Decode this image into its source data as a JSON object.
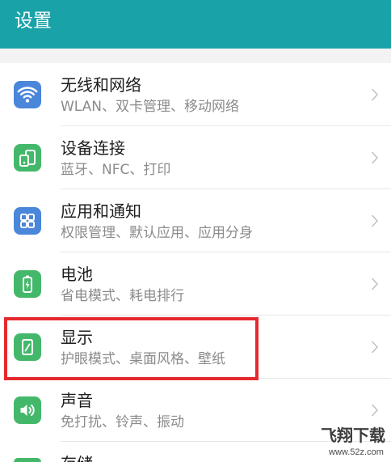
{
  "header": {
    "title": "设置"
  },
  "colors": {
    "header": "#19a2a8",
    "highlight": "#e42a2f"
  },
  "settings": {
    "items": [
      {
        "icon": "wifi-icon",
        "icon_color": "#4a86da",
        "title": "无线和网络",
        "subtitle": "WLAN、双卡管理、移动网络"
      },
      {
        "icon": "device-connection-icon",
        "icon_color": "#44b86a",
        "title": "设备连接",
        "subtitle": "蓝牙、NFC、打印"
      },
      {
        "icon": "apps-icon",
        "icon_color": "#4a86da",
        "title": "应用和通知",
        "subtitle": "权限管理、默认应用、应用分身"
      },
      {
        "icon": "battery-icon",
        "icon_color": "#44b86a",
        "title": "电池",
        "subtitle": "省电模式、耗电排行"
      },
      {
        "icon": "display-icon",
        "icon_color": "#44b86a",
        "title": "显示",
        "subtitle": "护眼模式、桌面风格、壁纸"
      },
      {
        "icon": "sound-icon",
        "icon_color": "#44b86a",
        "title": "声音",
        "subtitle": "免打扰、铃声、振动"
      },
      {
        "icon": "storage-icon",
        "icon_color": "#44b86a",
        "title": "存储"
      }
    ]
  },
  "watermark": {
    "brand": "飞翔下载",
    "url": "www.52z.com"
  }
}
